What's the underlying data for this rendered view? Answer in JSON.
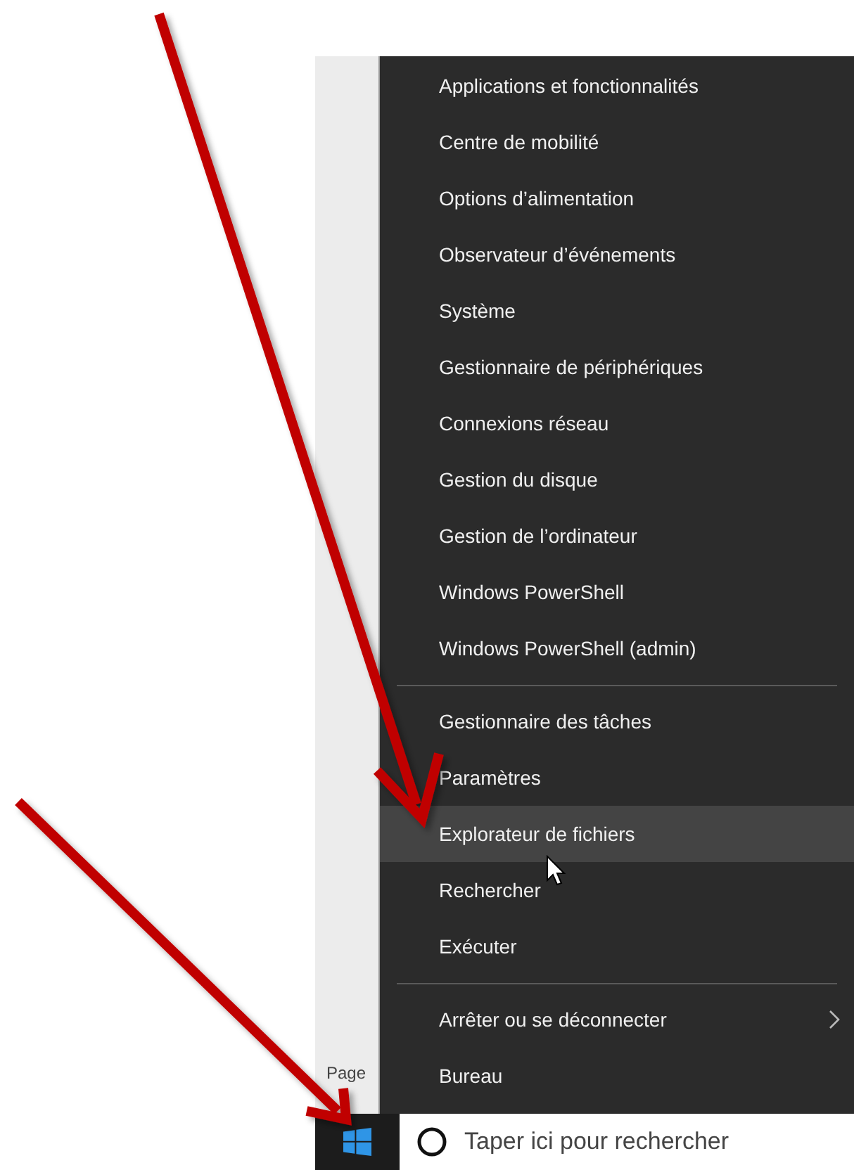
{
  "background": {
    "page_label": "Page"
  },
  "menu": {
    "groups": [
      [
        {
          "label": "Applications et fonctionnalités",
          "selected": false,
          "has_submenu": false
        },
        {
          "label": "Centre de mobilité",
          "selected": false,
          "has_submenu": false
        },
        {
          "label": "Options d’alimentation",
          "selected": false,
          "has_submenu": false
        },
        {
          "label": "Observateur d’événements",
          "selected": false,
          "has_submenu": false
        },
        {
          "label": "Système",
          "selected": false,
          "has_submenu": false
        },
        {
          "label": "Gestionnaire de périphériques",
          "selected": false,
          "has_submenu": false
        },
        {
          "label": "Connexions réseau",
          "selected": false,
          "has_submenu": false
        },
        {
          "label": "Gestion du disque",
          "selected": false,
          "has_submenu": false
        },
        {
          "label": "Gestion de l’ordinateur",
          "selected": false,
          "has_submenu": false
        },
        {
          "label": "Windows PowerShell",
          "selected": false,
          "has_submenu": false
        },
        {
          "label": "Windows PowerShell (admin)",
          "selected": false,
          "has_submenu": false
        }
      ],
      [
        {
          "label": "Gestionnaire des tâches",
          "selected": false,
          "has_submenu": false
        },
        {
          "label": "Paramètres",
          "selected": false,
          "has_submenu": false
        },
        {
          "label": "Explorateur de fichiers",
          "selected": true,
          "has_submenu": false
        },
        {
          "label": "Rechercher",
          "selected": false,
          "has_submenu": false
        },
        {
          "label": "Exécuter",
          "selected": false,
          "has_submenu": false
        }
      ],
      [
        {
          "label": "Arrêter ou se déconnecter",
          "selected": false,
          "has_submenu": true
        },
        {
          "label": "Bureau",
          "selected": false,
          "has_submenu": false
        }
      ]
    ]
  },
  "taskbar": {
    "search": {
      "placeholder": "Taper ici pour rechercher"
    }
  }
}
